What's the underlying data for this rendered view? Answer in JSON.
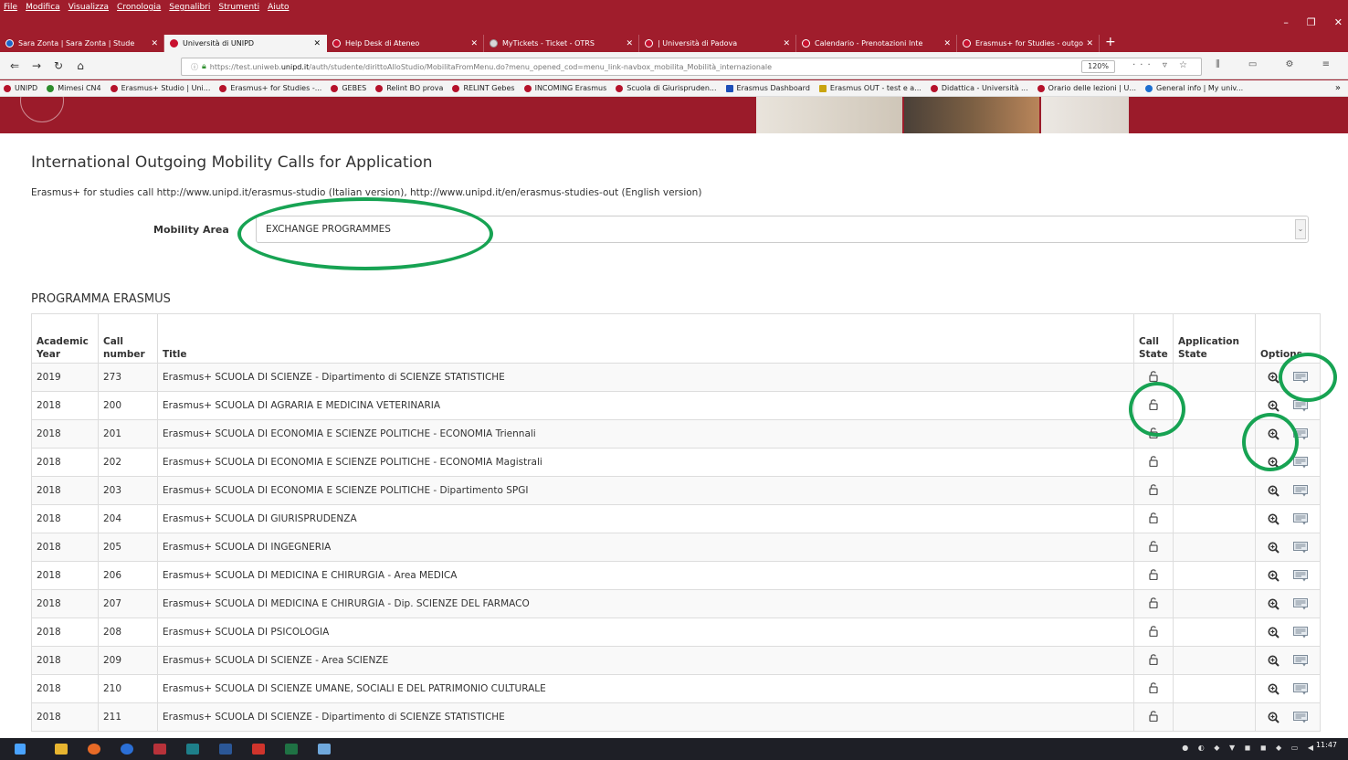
{
  "browser": {
    "menu": [
      "File",
      "Modifica",
      "Visualizza",
      "Cronologia",
      "Segnalibri",
      "Strumenti",
      "Aiuto"
    ],
    "window_controls": [
      "–",
      "❐",
      "✕"
    ],
    "tabs": [
      {
        "label": "Sara Zonta | Sara Zonta | Stude",
        "active": false
      },
      {
        "label": "Università di UNIPD",
        "active": true
      },
      {
        "label": "Help Desk di Ateneo",
        "active": false
      },
      {
        "label": "MyTickets - Ticket - OTRS",
        "active": false
      },
      {
        "label": "| Università di Padova",
        "active": false
      },
      {
        "label": "Calendario - Prenotazioni Inte",
        "active": false
      },
      {
        "label": "Erasmus+ for Studies - outgo",
        "active": false
      }
    ],
    "new_tab": "+",
    "url_prefix": "https://test.uniweb.",
    "url_domain": "unipd.it",
    "url_rest": "/auth/studente/dirittoAlloStudio/MobilitaFromMenu.do?menu_opened_cod=menu_link-navbox_mobilita_Mobilità_internazionale",
    "zoom": "120%",
    "bookmarks": [
      "UNIPD",
      "Mimesi CN4",
      "Erasmus+ Studio | Uni...",
      "Erasmus+ for Studies -...",
      "GEBES",
      "Relint BO prova",
      "RELINT Gebes",
      "INCOMING Erasmus",
      "Scuola di Giurispruden...",
      "Erasmus Dashboard",
      "Erasmus OUT - test e a...",
      "Didattica - Università ...",
      "Orario delle lezioni | U...",
      "General info | My univ..."
    ],
    "bookmarks_more": "»"
  },
  "page": {
    "title": "International Outgoing Mobility Calls for Application",
    "intro": "Erasmus+ for studies call http://www.unipd.it/erasmus-studio (Italian version), http://www.unipd.it/en/erasmus-studies-out (English version)",
    "mobility_area": {
      "label": "Mobility Area",
      "selected": "EXCHANGE PROGRAMMES"
    },
    "section_title": "PROGRAMMA ERASMUS",
    "table": {
      "headers": {
        "academic_year": "Academic Year",
        "call_number": "Call number",
        "title": "Title",
        "call_state": "Call State",
        "application_state": "Application State",
        "options": "Options"
      },
      "rows": [
        {
          "year": "2019",
          "number": "273",
          "title": "Erasmus+ SCUOLA DI SCIENZE - Dipartimento di SCIENZE STATISTICHE",
          "app_state": ""
        },
        {
          "year": "2018",
          "number": "200",
          "title": "Erasmus+ SCUOLA DI AGRARIA E MEDICINA VETERINARIA",
          "app_state": ""
        },
        {
          "year": "2018",
          "number": "201",
          "title": "Erasmus+ SCUOLA DI ECONOMIA E SCIENZE POLITICHE - ECONOMIA Triennali",
          "app_state": ""
        },
        {
          "year": "2018",
          "number": "202",
          "title": "Erasmus+ SCUOLA DI ECONOMIA E SCIENZE POLITICHE - ECONOMIA Magistrali",
          "app_state": ""
        },
        {
          "year": "2018",
          "number": "203",
          "title": "Erasmus+ SCUOLA DI ECONOMIA E SCIENZE POLITICHE - Dipartimento SPGI",
          "app_state": ""
        },
        {
          "year": "2018",
          "number": "204",
          "title": "Erasmus+ SCUOLA DI GIURISPRUDENZA",
          "app_state": ""
        },
        {
          "year": "2018",
          "number": "205",
          "title": "Erasmus+ SCUOLA DI INGEGNERIA",
          "app_state": ""
        },
        {
          "year": "2018",
          "number": "206",
          "title": "Erasmus+ SCUOLA DI MEDICINA E CHIRURGIA - Area MEDICA",
          "app_state": ""
        },
        {
          "year": "2018",
          "number": "207",
          "title": "Erasmus+ SCUOLA DI MEDICINA E CHIRURGIA - Dip. SCIENZE DEL FARMACO",
          "app_state": ""
        },
        {
          "year": "2018",
          "number": "208",
          "title": "Erasmus+ SCUOLA DI PSICOLOGIA",
          "app_state": ""
        },
        {
          "year": "2018",
          "number": "209",
          "title": "Erasmus+ SCUOLA DI SCIENZE - Area SCIENZE",
          "app_state": ""
        },
        {
          "year": "2018",
          "number": "210",
          "title": "Erasmus+ SCUOLA DI SCIENZE UMANE, SOCIALI E DEL PATRIMONIO CULTURALE",
          "app_state": ""
        },
        {
          "year": "2018",
          "number": "211",
          "title": "Erasmus+ SCUOLA DI SCIENZE - Dipartimento di SCIENZE STATISTICHE",
          "app_state": ""
        }
      ],
      "icons": {
        "call_state": "lock-open-icon",
        "view": "magnifier-plus-icon",
        "apply": "document-list-icon"
      }
    }
  },
  "taskbar": {
    "clock_time": "11:47"
  },
  "colors": {
    "brand": "#9b1b2a",
    "annotation": "#17a353",
    "table_border": "#dddddd"
  }
}
